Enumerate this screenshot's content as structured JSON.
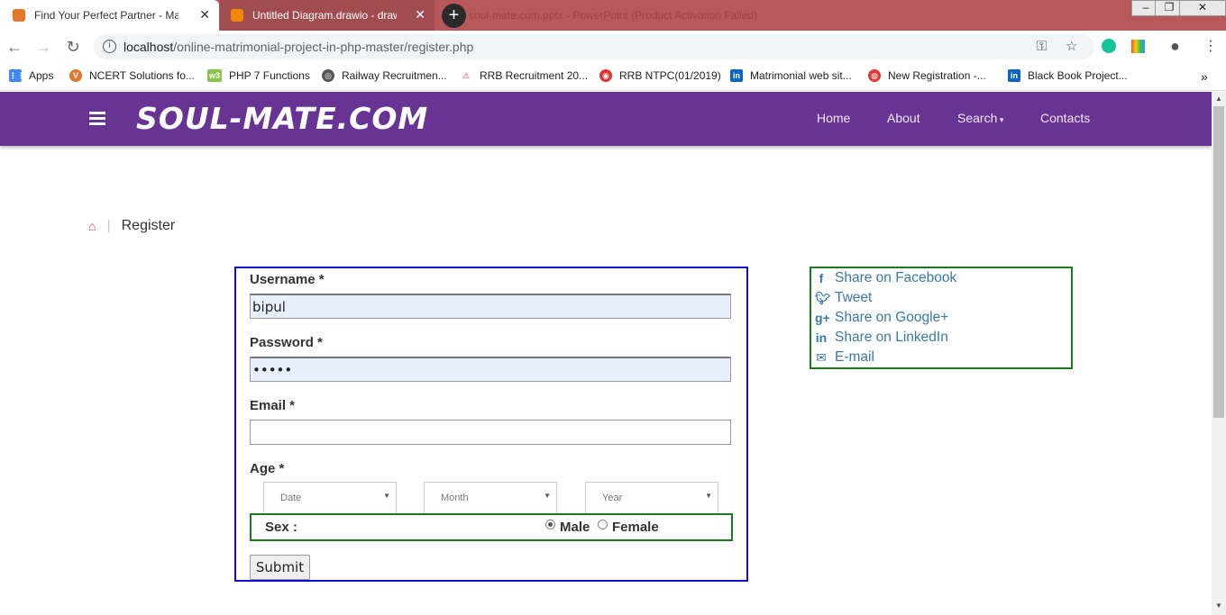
{
  "browser": {
    "tabs": [
      {
        "title": "Find Your Perfect Partner - Matri",
        "active": true
      },
      {
        "title": "Untitled Diagram.drawio - draw.i",
        "active": false
      }
    ],
    "ghost_title": "soul-mate.com.pptx - PowerPoint (Product Activation Failed)",
    "url_host": "localhost",
    "url_path": "/online-matrimonial-project-in-php-master/register.php",
    "bookmarks": [
      {
        "label": "Apps",
        "icon": "apps-grid-icon",
        "color": "#4285f4"
      },
      {
        "label": "NCERT Solutions fo...",
        "icon": "v-icon",
        "color": "#e2772e"
      },
      {
        "label": "PHP 7 Functions",
        "icon": "php-icon",
        "color": "#8bc34a"
      },
      {
        "label": "Railway Recruitmen...",
        "icon": "globe-icon",
        "color": "#555555"
      },
      {
        "label": "RRB Recruitment 20...",
        "icon": "rrb-icon",
        "color": "#d33"
      },
      {
        "label": "RRB NTPC(01/2019)",
        "icon": "rrb-ntpc-icon",
        "color": "#d33"
      },
      {
        "label": "Matrimonial web sit...",
        "icon": "linkedin-icon",
        "color": "#0a66c2"
      },
      {
        "label": "New Registration -...",
        "icon": "registration-icon",
        "color": "#e03a3a"
      },
      {
        "label": "Black Book Project...",
        "icon": "linkedin-icon",
        "color": "#0a66c2"
      }
    ]
  },
  "site": {
    "brand": "SOUL-MATE.COM",
    "brand_color": "#673494",
    "nav": [
      "Home",
      "About",
      "Search",
      "Contacts"
    ],
    "breadcrumb": "Register"
  },
  "form": {
    "username_label": "Username *",
    "username_value": "bipul",
    "password_label": "Password *",
    "password_value": "•••••",
    "email_label": "Email *",
    "email_value": "",
    "age_label": "Age *",
    "date_placeholder": "Date",
    "month_placeholder": "Month",
    "year_placeholder": "Year",
    "sex_label": "Sex :",
    "male_label": "Male",
    "female_label": "Female",
    "selected_sex": "Male",
    "submit_label": "Submit"
  },
  "share": [
    {
      "label": "Share on Facebook",
      "icon": "facebook-icon"
    },
    {
      "label": "Tweet",
      "icon": "twitter-icon"
    },
    {
      "label": "Share on Google+",
      "icon": "google-plus-icon"
    },
    {
      "label": "Share on LinkedIn",
      "icon": "linkedin-icon"
    },
    {
      "label": "E-mail",
      "icon": "email-icon"
    }
  ]
}
